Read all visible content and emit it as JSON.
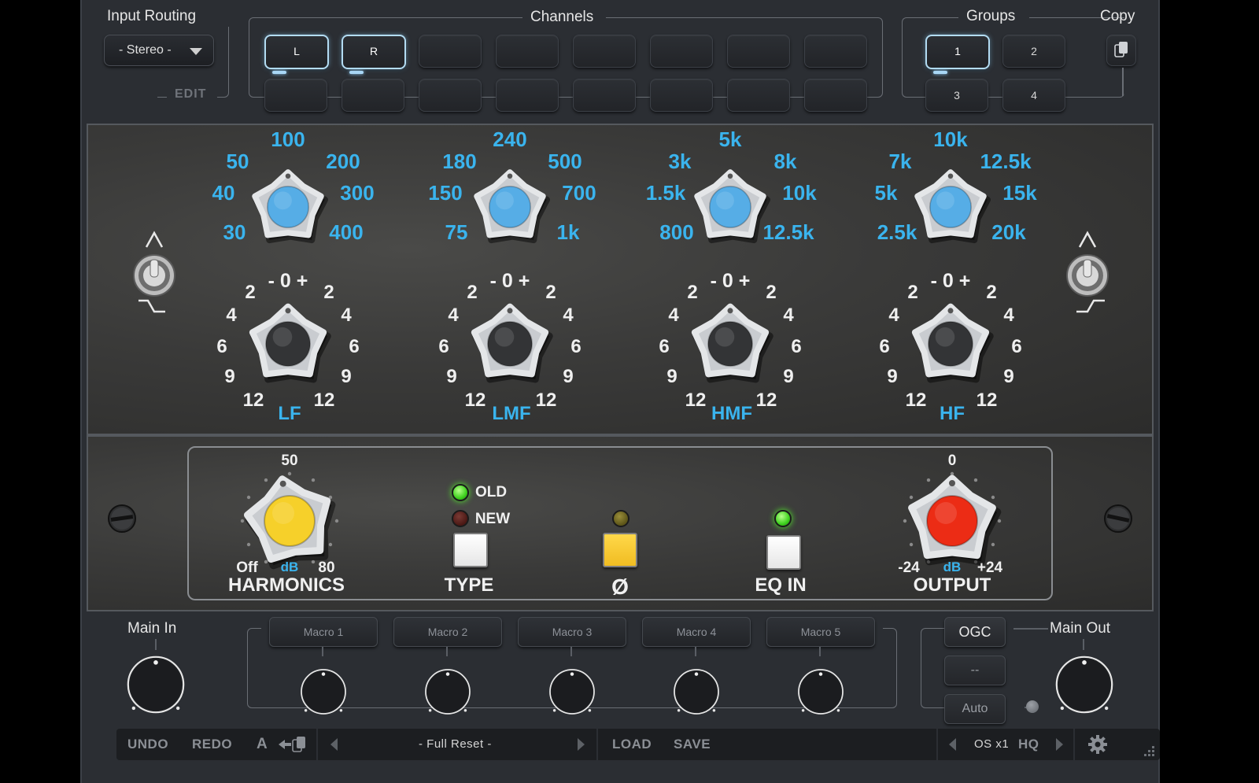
{
  "header": {
    "input_routing": {
      "label": "Input Routing",
      "value": "- Stereo -",
      "edit_label": "EDIT"
    },
    "channels": {
      "label": "Channels",
      "buttons": [
        "L",
        "R",
        "",
        "",
        "",
        "",
        "",
        "",
        "",
        "",
        "",
        "",
        "",
        "",
        "",
        ""
      ]
    },
    "groups": {
      "label": "Groups",
      "buttons": [
        "1",
        "2",
        "3",
        "4"
      ]
    },
    "copy": {
      "label": "Copy"
    }
  },
  "eq": {
    "bands": [
      {
        "name": "LF",
        "freq_labels": [
          "100",
          "50",
          "200",
          "40",
          "300",
          "30",
          "400"
        ]
      },
      {
        "name": "LMF",
        "freq_labels": [
          "240",
          "180",
          "500",
          "150",
          "700",
          "75",
          "1k"
        ]
      },
      {
        "name": "HMF",
        "freq_labels": [
          "5k",
          "3k",
          "8k",
          "1.5k",
          "10k",
          "800",
          "12.5k"
        ]
      },
      {
        "name": "HF",
        "freq_labels": [
          "10k",
          "7k",
          "12.5k",
          "5k",
          "15k",
          "2.5k",
          "20k"
        ]
      }
    ],
    "gain_scale": {
      "center": "- 0 +",
      "left": [
        "2",
        "4",
        "6",
        "9",
        "12"
      ],
      "right": [
        "2",
        "4",
        "6",
        "9",
        "12"
      ]
    },
    "colors": {
      "freq_knob": "#56ade6",
      "label_blue": "#3ab4ee"
    }
  },
  "controls": {
    "harmonics": {
      "name": "HARMONICS",
      "top": "50",
      "min": "Off",
      "max": "80",
      "unit": "dB",
      "color": "#f6d02a"
    },
    "type": {
      "name": "TYPE",
      "old": "OLD",
      "new": "NEW",
      "selected": "OLD"
    },
    "phase": {
      "name": "Ø",
      "active": true,
      "color": "#f4c530"
    },
    "eq_in": {
      "name": "EQ IN",
      "active": true
    },
    "output": {
      "name": "OUTPUT",
      "top": "0",
      "min": "-24",
      "max": "+24",
      "unit": "dB",
      "color": "#ec2c15"
    }
  },
  "bottom": {
    "main_in": "Main In",
    "main_out": "Main Out",
    "macros": [
      "Macro 1",
      "Macro 2",
      "Macro 3",
      "Macro 4",
      "Macro 5"
    ],
    "ogc": "OGC",
    "ogc_value": "--",
    "auto": "Auto"
  },
  "toolbar": {
    "undo": "UNDO",
    "redo": "REDO",
    "ab": "A",
    "preset": "- Full Reset -",
    "load": "LOAD",
    "save": "SAVE",
    "os": "OS x1",
    "quality": "HQ"
  }
}
